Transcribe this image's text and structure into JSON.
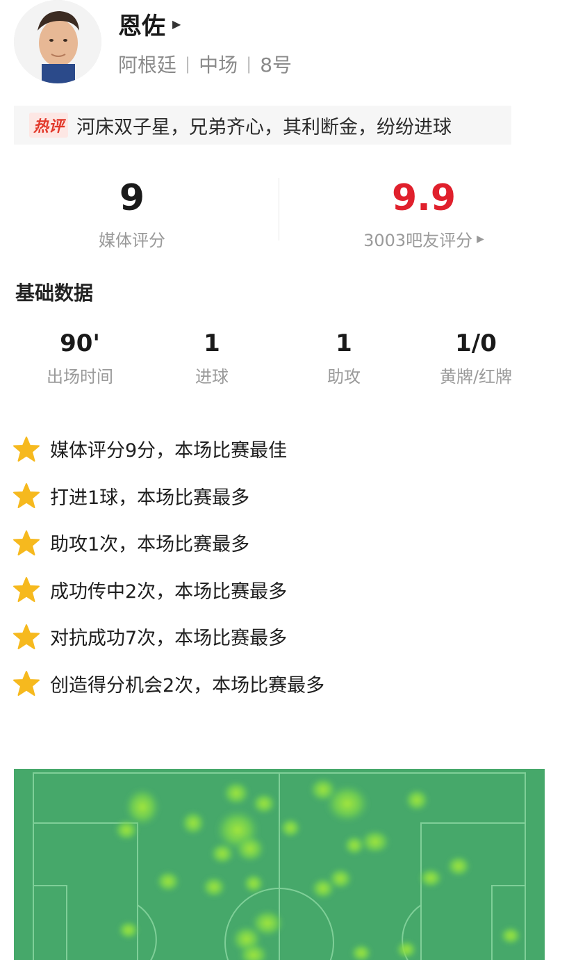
{
  "player": {
    "name": "恩佐",
    "nationality": "阿根廷",
    "position": "中场",
    "number": "8号"
  },
  "hot_comment": {
    "tag": "热评",
    "text": "河床双子星，兄弟齐心，其利断金，纷纷进球"
  },
  "ratings": {
    "media": {
      "value": "9",
      "label": "媒体评分"
    },
    "fans": {
      "value": "9.9",
      "label": "3003吧友评分"
    }
  },
  "basic_section_title": "基础数据",
  "basic_stats": [
    {
      "value": "90'",
      "label": "出场时间"
    },
    {
      "value": "1",
      "label": "进球"
    },
    {
      "value": "1",
      "label": "助攻"
    },
    {
      "value": "1/0",
      "label": "黄牌/红牌"
    }
  ],
  "highlights": [
    "媒体评分9分，本场比赛最佳",
    "打进1球，本场比赛最多",
    "助攻1次，本场比赛最多",
    "成功传中2次，本场比赛最多",
    "对抗成功7次，本场比赛最多",
    "创造得分机会2次，本场比赛最多"
  ],
  "colors": {
    "accent_red": "#e0202c",
    "star": "#f6b91e",
    "pitch": "#46a86a",
    "heat": "#8de04a"
  },
  "icons": {
    "name_arrow": "play-triangle-icon",
    "fans_arrow": "play-triangle-icon",
    "highlight": "star-icon"
  }
}
